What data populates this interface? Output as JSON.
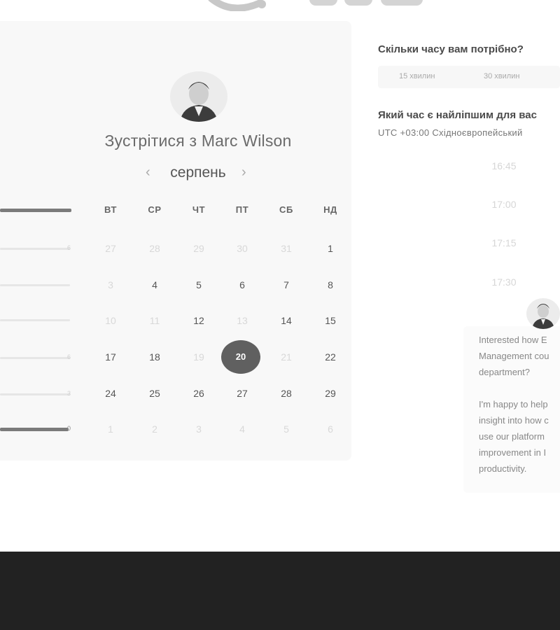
{
  "colors": {
    "footer": "#222222",
    "selected_day": "#606060",
    "card": "#f8f8f8"
  },
  "icons": {
    "logo": "brand-logo",
    "avatar": "person-avatar",
    "prev": "chevron-left",
    "next": "chevron-right"
  },
  "calendar": {
    "title_prefix": "Зустрітися з",
    "host_name": "Marc Wilson",
    "month": "серпень",
    "prev_symbol": "‹",
    "next_symbol": "›",
    "weekdays": [
      "ВТ",
      "СР",
      "ЧТ",
      "ПТ",
      "СБ",
      "НД"
    ],
    "weeks": [
      [
        "27",
        "28",
        "29",
        "30",
        "31",
        "1"
      ],
      [
        "3",
        "4",
        "5",
        "6",
        "7",
        "8"
      ],
      [
        "10",
        "11",
        "12",
        "13",
        "14",
        "15"
      ],
      [
        "17",
        "18",
        "19",
        "20",
        "21",
        "22"
      ],
      [
        "24",
        "25",
        "26",
        "27",
        "28",
        "29"
      ],
      [
        "1",
        "2",
        "3",
        "4",
        "5",
        "6"
      ]
    ],
    "selected_day": "20"
  },
  "left_ticks": [
    "6",
    "3",
    "0"
  ],
  "duration": {
    "question": "Скільки часу вам потрібно?",
    "options": [
      "15 хвилин",
      "30 хвилин"
    ]
  },
  "time": {
    "question": "Який час є найліпшим для вас",
    "timezone": "UTC +03:00 Східноєвропейський",
    "slots": [
      "16:45",
      "17:00",
      "17:15",
      "17:30"
    ]
  },
  "message": {
    "lines": [
      "Interested how E",
      "Management cou",
      "department?",
      "",
      "I'm happy to help",
      "insight into how c",
      "use our platform",
      "improvement in I",
      "productivity."
    ]
  }
}
